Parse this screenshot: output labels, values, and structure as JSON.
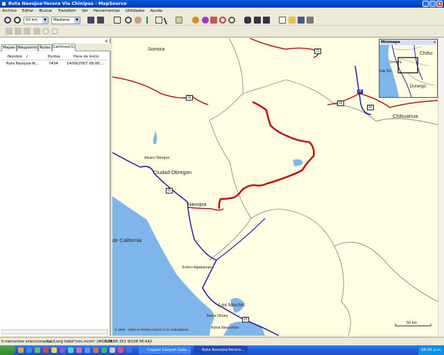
{
  "window": {
    "title": "Ruta Navojoa-Yecora Via Chinipas - MapSource",
    "minimize": "_",
    "maximize": "□",
    "close": "x"
  },
  "menu": [
    "Archivo",
    "Editar",
    "Buscar",
    "Transferir",
    "Ver",
    "Herramientas",
    "Utilidades",
    "Ayuda"
  ],
  "toolbar": {
    "scale_value": "50 km",
    "detail_value": "Mediano"
  },
  "left_pane": {
    "close": "x",
    "tabs": [
      "Mapas",
      "Waypoints",
      "Rutas",
      "Caminos(1)"
    ],
    "active_tab": 3,
    "columns": [
      "Nombre",
      "/",
      "Puntos",
      "Hora de inicio"
    ],
    "rows": [
      {
        "name": "Ruta Navojoa-Ye...",
        "points": "7434",
        "start": "14/09/2007 08:00:..."
      }
    ]
  },
  "map": {
    "labels": {
      "sonora": "Sonora",
      "chihuahua": "Chihuahua",
      "alvaro": "Alvaro Obregon",
      "obregon": "Ciudad Obregon",
      "navojoa": "Navojoa",
      "california": "de California",
      "estero": "Estero Agiabampo",
      "mochis": "Los Mochis",
      "ohuira": "Bahía Ohuira",
      "navachiste": "Bahía Navachiste"
    },
    "shields": [
      "23",
      "16",
      "28",
      "16",
      "16",
      "15",
      "15"
    ],
    "copyright": "© 1995 - 2004 GARMIN Limited or its Subsidiaries",
    "scale": "50 km",
    "colors": {
      "land": "#fffde2",
      "water": "#7eb6ec",
      "track": "#c01010",
      "highway": "#1a1aa8",
      "secondary": "#b01818"
    }
  },
  "minimap": {
    "title": "Minimapa",
    "close": "x",
    "labels": {
      "chihu": "Chihu",
      "sonora": "Sonora",
      "nia": "nia Su",
      "durango": "Durango"
    }
  },
  "status": {
    "selected": "0 elementos seleccionados",
    "format": "Lat/Long hddd°mm.mmm' (WGS 84)",
    "coords": "N28 36.351 W108 56.642"
  },
  "taskbar": {
    "task1": "Copper Canyon Gate ...",
    "task2": "Ruta Navojoa-Yecora...",
    "clock": "08:56 p.m."
  }
}
